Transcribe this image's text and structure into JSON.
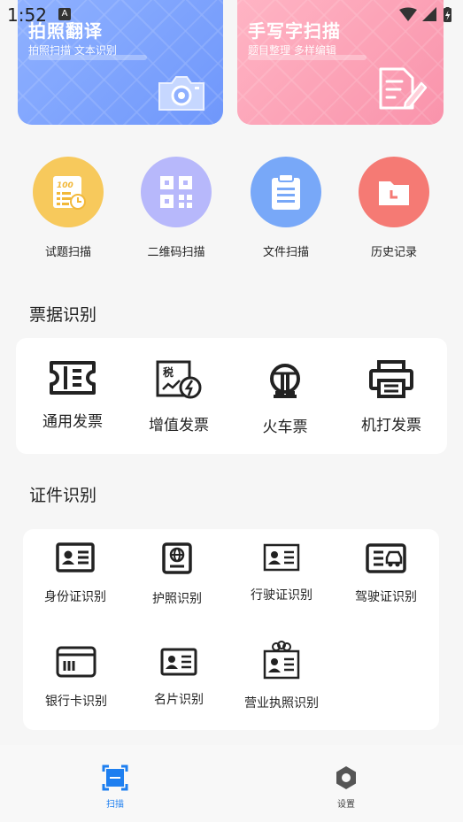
{
  "status_bar": {
    "time": "1:52",
    "notification_badge": "A"
  },
  "banners": [
    {
      "title": "拍照翻译",
      "subtitle": "拍照扫描  文本识别",
      "icon": "camera-icon"
    },
    {
      "title": "手写字扫描",
      "subtitle": "题目整理  多样编辑",
      "icon": "edit-document-icon"
    }
  ],
  "quick_tools": [
    {
      "label": "试题扫描",
      "icon": "exam-paper-icon",
      "color": "#f7c95c"
    },
    {
      "label": "二维码扫描",
      "icon": "qr-code-icon",
      "color": "#b7b8fb"
    },
    {
      "label": "文件扫描",
      "icon": "clipboard-icon",
      "color": "#78a8f8"
    },
    {
      "label": "历史记录",
      "icon": "folder-clock-icon",
      "color": "#f57a74"
    }
  ],
  "receipt_section": {
    "title": "票据识别",
    "items": [
      {
        "label": "通用发票",
        "icon": "ticket-icon"
      },
      {
        "label": "增值发票",
        "icon": "tax-invoice-icon"
      },
      {
        "label": "火车票",
        "icon": "train-icon"
      },
      {
        "label": "机打发票",
        "icon": "printer-icon"
      }
    ]
  },
  "certificate_section": {
    "title": "证件识别",
    "items": [
      {
        "label": "身份证识别",
        "icon": "id-card-icon"
      },
      {
        "label": "护照识别",
        "icon": "passport-icon"
      },
      {
        "label": "行驶证识别",
        "icon": "vehicle-license-icon"
      },
      {
        "label": "驾驶证识别",
        "icon": "driver-license-icon"
      },
      {
        "label": "银行卡识别",
        "icon": "bank-card-icon"
      },
      {
        "label": "名片识别",
        "icon": "business-card-icon"
      },
      {
        "label": "营业执照识别",
        "icon": "business-license-icon"
      }
    ]
  },
  "bottom_nav": [
    {
      "label": "扫描",
      "icon": "scan-icon",
      "active": true
    },
    {
      "label": "设置",
      "icon": "settings-icon",
      "active": false
    }
  ],
  "colors": {
    "active": "#1e7ff0",
    "inactive": "#555555",
    "blue_card": "#7fa3fd",
    "pink_card": "#fca1b6"
  }
}
